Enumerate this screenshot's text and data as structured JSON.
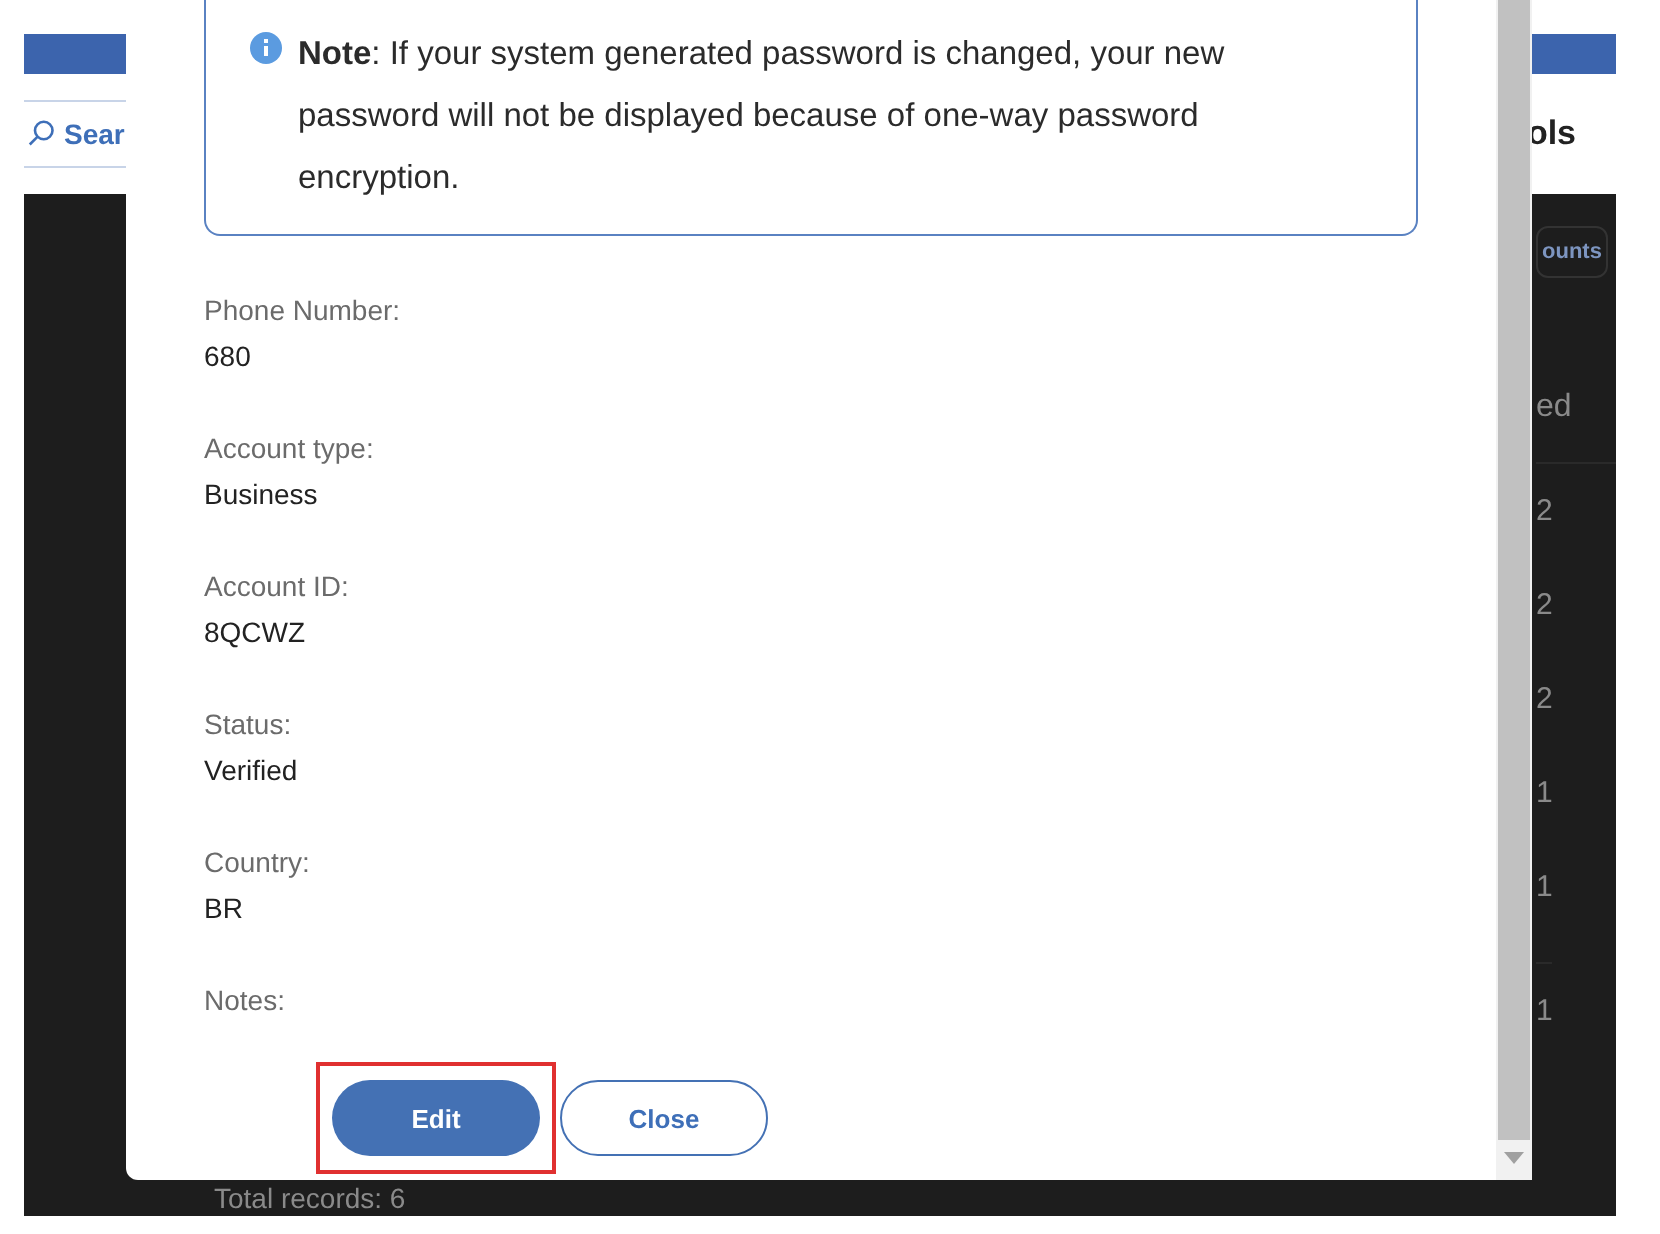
{
  "background_page": {
    "search": {
      "placeholder": "Sear"
    },
    "title_fragment": "ols",
    "button_fragment": "ounts",
    "column_fragment": "ed",
    "cells": [
      "2",
      "2",
      "2",
      "1",
      "1",
      "1"
    ],
    "total": "Total records: 6"
  },
  "modal": {
    "note": "**Note**: If your system generated password is changed, your new password will not be displayed because of one-way password encryption.",
    "fields": [
      {
        "label": "Phone Number:",
        "value": "680"
      },
      {
        "label": "Account type:",
        "value": "Business"
      },
      {
        "label": "Account ID:",
        "value": "8QCWZ"
      },
      {
        "label": "Status:",
        "value": "Verified"
      },
      {
        "label": "Country:",
        "value": "BR"
      },
      {
        "label": "Notes:"
      }
    ],
    "buttons": [
      {
        "label": "Edit",
        "kind": "primary",
        "highlighted": true
      },
      {
        "label": "Close",
        "kind": "secondary",
        "highlighted": false
      }
    ]
  }
}
